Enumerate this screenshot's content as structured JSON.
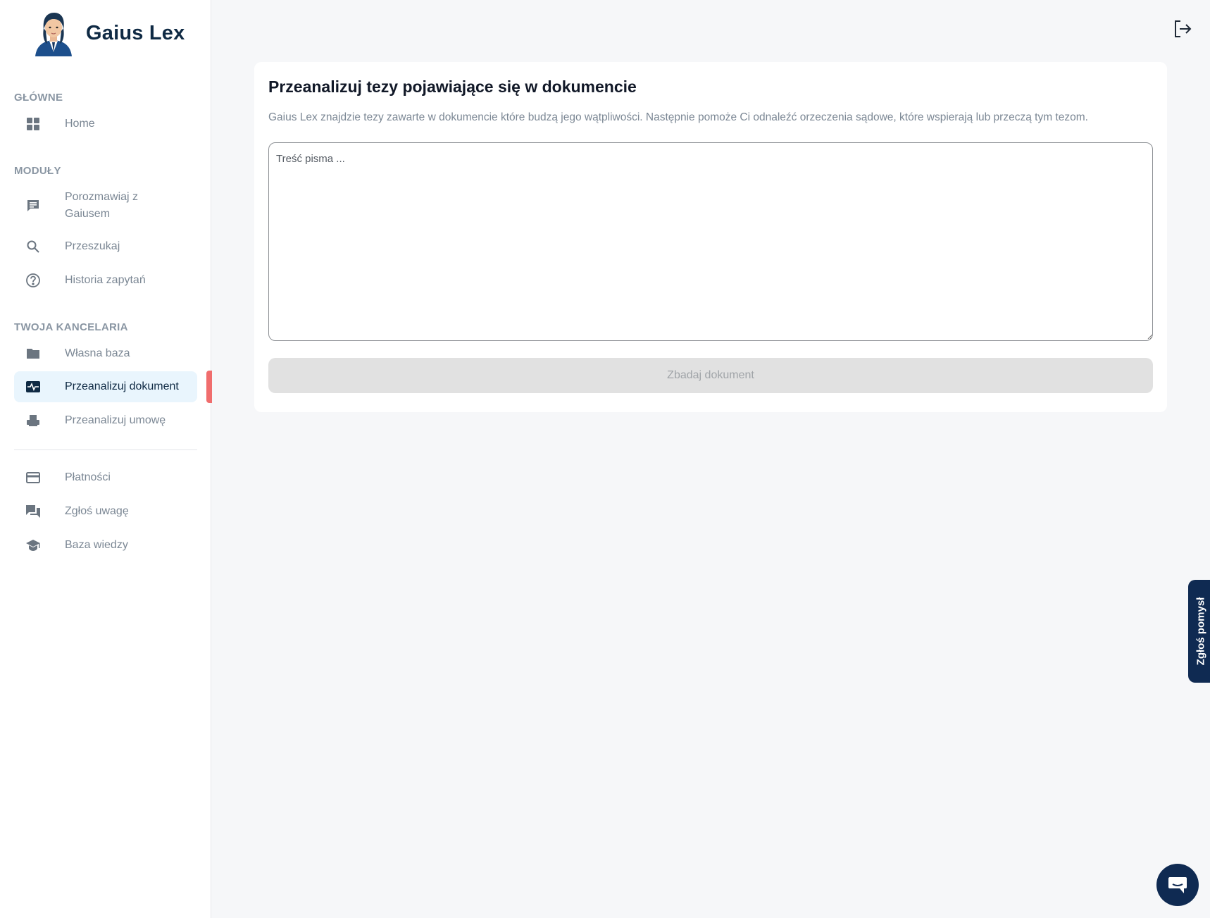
{
  "brand": {
    "name": "Gaius Lex"
  },
  "sidebar": {
    "sections": [
      {
        "label": "GŁÓWNE"
      },
      {
        "label": "MODUŁY"
      },
      {
        "label": "TWOJA KANCELARIA"
      }
    ],
    "items": [
      {
        "label": "Home",
        "icon": "dashboard-icon"
      },
      {
        "label": "Porozmawiaj z Gaiusem",
        "icon": "chat-icon"
      },
      {
        "label": "Przeszukaj",
        "icon": "search-icon"
      },
      {
        "label": "Historia zapytań",
        "icon": "help-circle-icon"
      },
      {
        "label": "Własna baza",
        "icon": "folder-icon"
      },
      {
        "label": "Przeanalizuj dokument",
        "icon": "monitor-heart-icon",
        "active": true
      },
      {
        "label": "Przeanalizuj umowę",
        "icon": "printer-icon"
      },
      {
        "label": "Płatności",
        "icon": "credit-card-icon"
      },
      {
        "label": "Zgłoś uwagę",
        "icon": "forum-icon"
      },
      {
        "label": "Baza wiedzy",
        "icon": "school-icon"
      }
    ]
  },
  "main": {
    "title": "Przeanalizuj tezy pojawiające się w dokumencie",
    "description": "Gaius Lex znajdzie tezy zawarte w dokumencie które budzą jego wątpliwości. Następnie pomoże Ci odnaleźć orzeczenia sądowe, które wspierają lub przeczą tym tezom.",
    "textarea": {
      "placeholder": "Treść pisma ...",
      "value": ""
    },
    "submit_label": "Zbadaj dokument"
  },
  "feedback_tab": {
    "label": "Zgłoś pomysł"
  },
  "colors": {
    "brand_navy": "#0f2a52",
    "active_bg": "#e9f5fd",
    "active_marker": "#f06d6d",
    "page_bg": "#f6f7f9"
  }
}
